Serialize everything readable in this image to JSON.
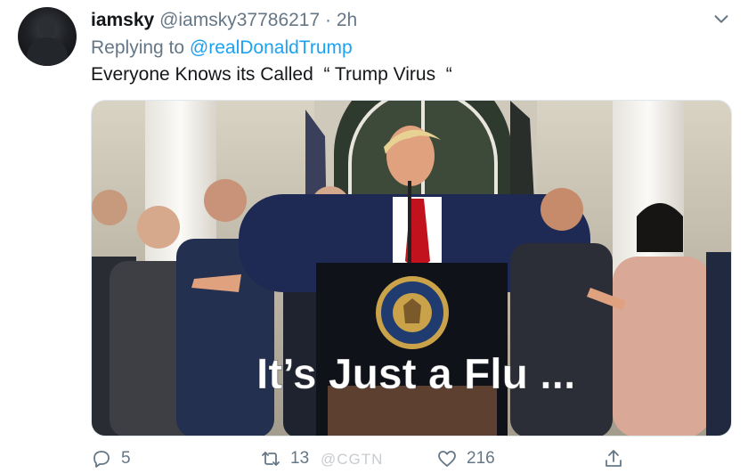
{
  "user": {
    "display_name": "iamsky",
    "handle": "@iamsky37786217",
    "separator": "·",
    "time": "2h",
    "avatar_icon": "hooded-figure-avatar"
  },
  "reply": {
    "prefix": "Replying to",
    "target": "@realDonaldTrump"
  },
  "tweet_text": "Everyone Knows its Called  “ Trump Virus  “",
  "media": {
    "caption": "It’s Just a Flu ..."
  },
  "actions": {
    "reply_count": "5",
    "retweet_count": "13",
    "like_count": "216"
  },
  "watermark": "@CGTN",
  "icons": {
    "menu": "chevron-down-icon",
    "reply": "reply-icon",
    "retweet": "retweet-icon",
    "like": "heart-icon",
    "share": "share-icon"
  },
  "colors": {
    "link": "#1da1f2",
    "secondary_text": "#657786",
    "primary_text": "#14171a"
  }
}
